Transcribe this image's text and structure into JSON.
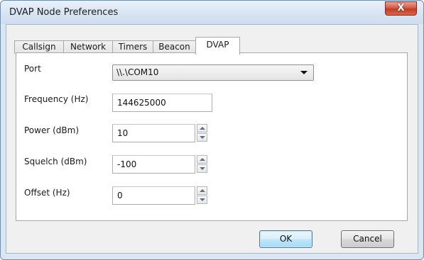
{
  "window": {
    "title": "DVAP Node Preferences",
    "close_glyph": "X"
  },
  "tabs": [
    {
      "label": "Callsign",
      "active": false
    },
    {
      "label": "Network",
      "active": false
    },
    {
      "label": "Timers",
      "active": false
    },
    {
      "label": "Beacon",
      "active": false
    },
    {
      "label": "DVAP",
      "active": true
    }
  ],
  "fields": {
    "port": {
      "label": "Port",
      "value": "\\\\.\\COM10"
    },
    "frequency": {
      "label": "Frequency (Hz)",
      "value": "144625000"
    },
    "power": {
      "label": "Power (dBm)",
      "value": "10"
    },
    "squelch": {
      "label": "Squelch (dBm)",
      "value": "-100"
    },
    "offset": {
      "label": "Offset (Hz)",
      "value": "0"
    }
  },
  "buttons": {
    "ok": "OK",
    "cancel": "Cancel"
  },
  "icons": {
    "close": "close-icon",
    "dropdown": "chevron-down-icon",
    "spin_up": "arrow-up-icon",
    "spin_down": "arrow-down-icon"
  }
}
